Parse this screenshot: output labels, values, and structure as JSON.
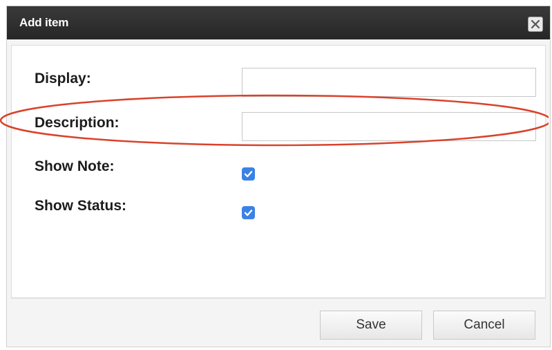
{
  "dialog": {
    "title": "Add item",
    "close_icon": "close-icon"
  },
  "form": {
    "display_label": "Display:",
    "display_value": "",
    "description_label": "Description:",
    "description_value": "",
    "show_note_label": "Show Note:",
    "show_note_checked": true,
    "show_status_label": "Show Status:",
    "show_status_checked": true
  },
  "annotation": {
    "ellipse_color": "#d9422b"
  },
  "footer": {
    "save_label": "Save",
    "cancel_label": "Cancel"
  },
  "colors": {
    "titlebar": "#2c2c2c",
    "checkbox": "#3b82e6"
  }
}
